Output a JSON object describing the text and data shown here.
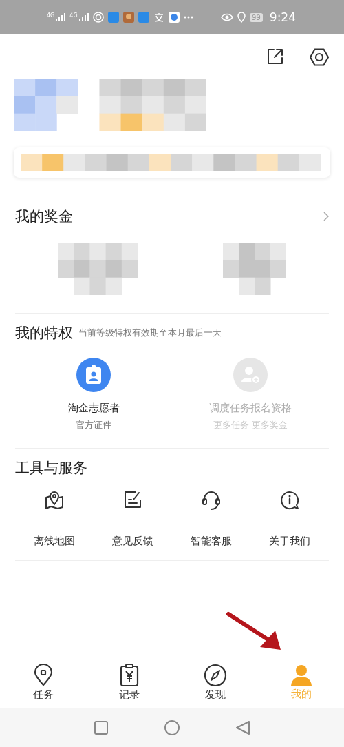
{
  "status_bar": {
    "network_labels": [
      "4G",
      "4G"
    ],
    "battery": "99",
    "time": "9:24"
  },
  "bonus": {
    "title": "我的奖金"
  },
  "privileges": {
    "title": "我的特权",
    "note": "当前等级特权有效期至本月最后一天",
    "items": [
      {
        "name": "淘金志愿者",
        "sub": "官方证件",
        "disabled": false,
        "kind": "badge"
      },
      {
        "name": "调度任务报名资格",
        "sub": "更多任务 更多奖金",
        "disabled": true,
        "kind": "signup"
      }
    ]
  },
  "tools": {
    "title": "工具与服务",
    "items": [
      {
        "label": "离线地图",
        "kind": "map"
      },
      {
        "label": "意见反馈",
        "kind": "feedback"
      },
      {
        "label": "智能客服",
        "kind": "support"
      },
      {
        "label": "关于我们",
        "kind": "about"
      }
    ]
  },
  "tabs": [
    {
      "label": "任务",
      "kind": "task",
      "selected": false
    },
    {
      "label": "记录",
      "kind": "record",
      "selected": false
    },
    {
      "label": "发现",
      "kind": "discover",
      "selected": false
    },
    {
      "label": "我的",
      "kind": "me",
      "selected": true
    }
  ]
}
